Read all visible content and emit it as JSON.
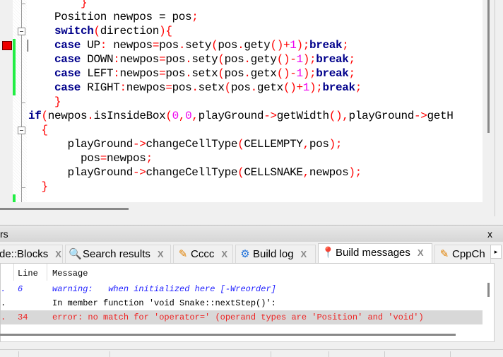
{
  "editor": {
    "lines": [
      [
        [
          "op",
          "        }"
        ]
      ],
      [
        [
          "id",
          "    Position newpos = pos"
        ],
        [
          "op",
          ";"
        ]
      ],
      [
        [
          "kw",
          "    switch"
        ],
        [
          "op",
          "("
        ],
        [
          "id",
          "direction"
        ],
        [
          "op",
          "){"
        ]
      ],
      [
        [
          "kw",
          "    case"
        ],
        [
          "id",
          " UP"
        ],
        [
          "op",
          ":"
        ],
        [
          "id",
          " newpos"
        ],
        [
          "op",
          "="
        ],
        [
          "id",
          "pos"
        ],
        [
          "op",
          "."
        ],
        [
          "id",
          "sety"
        ],
        [
          "op",
          "("
        ],
        [
          "id",
          "pos"
        ],
        [
          "op",
          "."
        ],
        [
          "id",
          "gety"
        ],
        [
          "op",
          "()+"
        ],
        [
          "num",
          "1"
        ],
        [
          "op",
          ");"
        ],
        [
          "kw",
          "break"
        ],
        [
          "op",
          ";"
        ]
      ],
      [
        [
          "kw",
          "    case"
        ],
        [
          "id",
          " DOWN"
        ],
        [
          "op",
          ":"
        ],
        [
          "id",
          "newpos"
        ],
        [
          "op",
          "="
        ],
        [
          "id",
          "pos"
        ],
        [
          "op",
          "."
        ],
        [
          "id",
          "sety"
        ],
        [
          "op",
          "("
        ],
        [
          "id",
          "pos"
        ],
        [
          "op",
          "."
        ],
        [
          "id",
          "gety"
        ],
        [
          "op",
          "()-"
        ],
        [
          "num",
          "1"
        ],
        [
          "op",
          ");"
        ],
        [
          "kw",
          "break"
        ],
        [
          "op",
          ";"
        ]
      ],
      [
        [
          "kw",
          "    case"
        ],
        [
          "id",
          " LEFT"
        ],
        [
          "op",
          ":"
        ],
        [
          "id",
          "newpos"
        ],
        [
          "op",
          "="
        ],
        [
          "id",
          "pos"
        ],
        [
          "op",
          "."
        ],
        [
          "id",
          "setx"
        ],
        [
          "op",
          "("
        ],
        [
          "id",
          "pos"
        ],
        [
          "op",
          "."
        ],
        [
          "id",
          "getx"
        ],
        [
          "op",
          "()-"
        ],
        [
          "num",
          "1"
        ],
        [
          "op",
          ");"
        ],
        [
          "kw",
          "break"
        ],
        [
          "op",
          ";"
        ]
      ],
      [
        [
          "kw",
          "    case"
        ],
        [
          "id",
          " RIGHT"
        ],
        [
          "op",
          ":"
        ],
        [
          "id",
          "newpos"
        ],
        [
          "op",
          "="
        ],
        [
          "id",
          "pos"
        ],
        [
          "op",
          "."
        ],
        [
          "id",
          "setx"
        ],
        [
          "op",
          "("
        ],
        [
          "id",
          "pos"
        ],
        [
          "op",
          "."
        ],
        [
          "id",
          "getx"
        ],
        [
          "op",
          "()+"
        ],
        [
          "num",
          "1"
        ],
        [
          "op",
          ");"
        ],
        [
          "kw",
          "break"
        ],
        [
          "op",
          ";"
        ]
      ],
      [
        [
          "op",
          "    }"
        ]
      ],
      [
        [
          "kw",
          "if"
        ],
        [
          "op",
          "("
        ],
        [
          "id",
          "newpos"
        ],
        [
          "op",
          "."
        ],
        [
          "id",
          "isInsideBox"
        ],
        [
          "op",
          "("
        ],
        [
          "num",
          "0"
        ],
        [
          "op",
          ","
        ],
        [
          "num",
          "0"
        ],
        [
          "op",
          ","
        ],
        [
          "id",
          "playGround"
        ],
        [
          "op",
          "->"
        ],
        [
          "id",
          "getWidth"
        ],
        [
          "op",
          "(),"
        ],
        [
          "id",
          "playGround"
        ],
        [
          "op",
          "->"
        ],
        [
          "id",
          "getH"
        ]
      ],
      [
        [
          "op",
          "  {"
        ]
      ],
      [
        [
          "id",
          "      playGround"
        ],
        [
          "op",
          "->"
        ],
        [
          "id",
          "changeCellType"
        ],
        [
          "op",
          "("
        ],
        [
          "id",
          "CELLEMPTY"
        ],
        [
          "op",
          ","
        ],
        [
          "id",
          "pos"
        ],
        [
          "op",
          ");"
        ]
      ],
      [
        [
          "id",
          "        pos"
        ],
        [
          "op",
          "="
        ],
        [
          "id",
          "newpos"
        ],
        [
          "op",
          ";"
        ]
      ],
      [
        [
          "id",
          "      playGround"
        ],
        [
          "op",
          "->"
        ],
        [
          "id",
          "changeCellType"
        ],
        [
          "op",
          "("
        ],
        [
          "id",
          "CELLSNAKE"
        ],
        [
          "op",
          ","
        ],
        [
          "id",
          "newpos"
        ],
        [
          "op",
          ");"
        ]
      ],
      [
        [
          "op",
          "  }"
        ]
      ]
    ]
  },
  "panel": {
    "title": "rs",
    "close": "x",
    "tabs": [
      {
        "label": "de::Blocks",
        "icon": "",
        "close": "X"
      },
      {
        "label": "Search results",
        "icon": "magnifier",
        "close": "X"
      },
      {
        "label": "Cccc",
        "icon": "pencil",
        "close": "X"
      },
      {
        "label": "Build log",
        "icon": "gear",
        "close": "X"
      },
      {
        "label": "Build messages",
        "icon": "pushpin",
        "close": "X",
        "active": true
      },
      {
        "label": "CppCh",
        "icon": "pencil",
        "close": ""
      }
    ],
    "tab_scroll": "▸",
    "columns": {
      "line": "Line",
      "message": "Message"
    },
    "rows": [
      {
        "file": ".",
        "line": "6",
        "message": "warning:   when initialized here [-Wreorder]",
        "kind": "warning"
      },
      {
        "file": ".",
        "line": "",
        "message": "In member function 'void Snake::nextStep()':",
        "kind": "info"
      },
      {
        "file": ".",
        "line": "34",
        "message": "error: no match for 'operator=' (operand types are 'Position' and 'void')",
        "kind": "error"
      }
    ]
  },
  "colors": {
    "warning": "#2222ff",
    "error": "#ee2222",
    "info": "#000000",
    "keyword": "#00008b",
    "operator": "#ff0000",
    "number": "#ee00ee"
  }
}
